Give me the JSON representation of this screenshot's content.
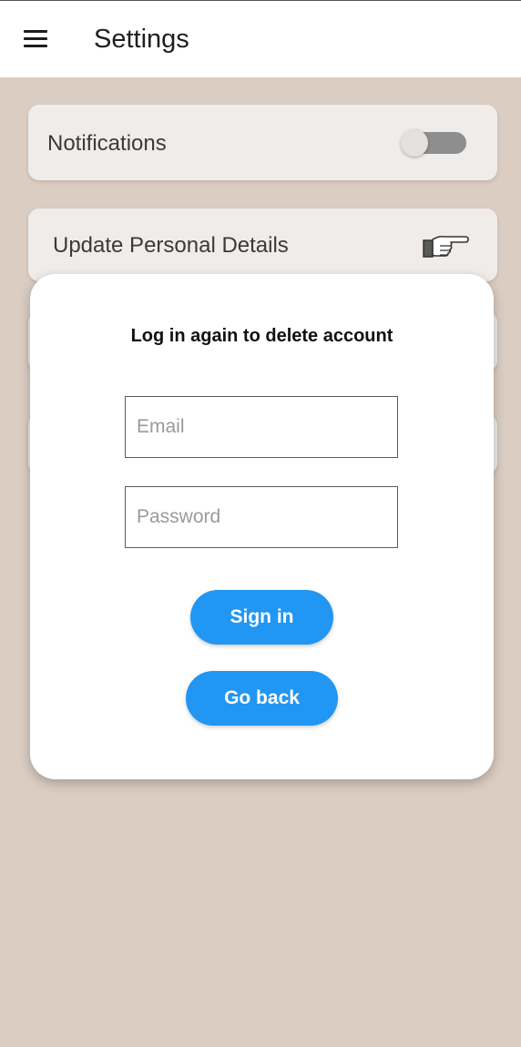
{
  "header": {
    "title": "Settings",
    "menu_icon": "hamburger-menu-icon"
  },
  "settings": {
    "notifications": {
      "label": "Notifications",
      "toggle_on": false
    },
    "personal_details": {
      "label": "Update Personal Details",
      "icon": "pointing-hand-icon"
    }
  },
  "dialog": {
    "title": "Log in again to delete account",
    "email_placeholder": "Email",
    "password_placeholder": "Password",
    "sign_in_label": "Sign in",
    "go_back_label": "Go back"
  },
  "colors": {
    "background": "#dbcdc2",
    "card": "#f0ecea",
    "accent": "#2196f3"
  }
}
